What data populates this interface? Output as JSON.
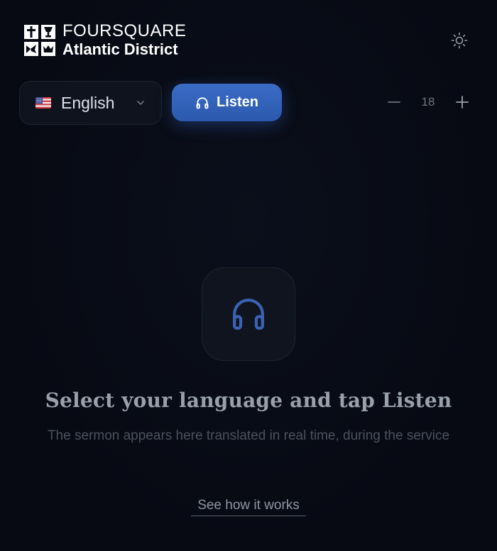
{
  "brand": {
    "line1": "FOURSQUARE",
    "line2": "Atlantic District",
    "logo_cells": [
      "cross-icon",
      "chalice-icon",
      "dove-icon",
      "crown-icon"
    ]
  },
  "header": {
    "theme_icon": "sun-icon"
  },
  "controls": {
    "language": {
      "flag_icon": "us-flag-icon",
      "label": "English",
      "chevron_icon": "chevron-down-icon"
    },
    "listen": {
      "icon": "headphones-icon",
      "label": "Listen"
    },
    "font_size": {
      "decrease_icon": "minus-icon",
      "value": "18",
      "increase_icon": "plus-icon"
    }
  },
  "empty_state": {
    "icon": "headphones-icon",
    "title": "Select your language and tap Listen",
    "subtitle": "The sermon appears here translated in real time, during the service",
    "link": "See how it works"
  },
  "colors": {
    "background": "#080b14",
    "accent": "#3264bb",
    "card": "#10141e",
    "icon_accent": "#3a63b4"
  }
}
